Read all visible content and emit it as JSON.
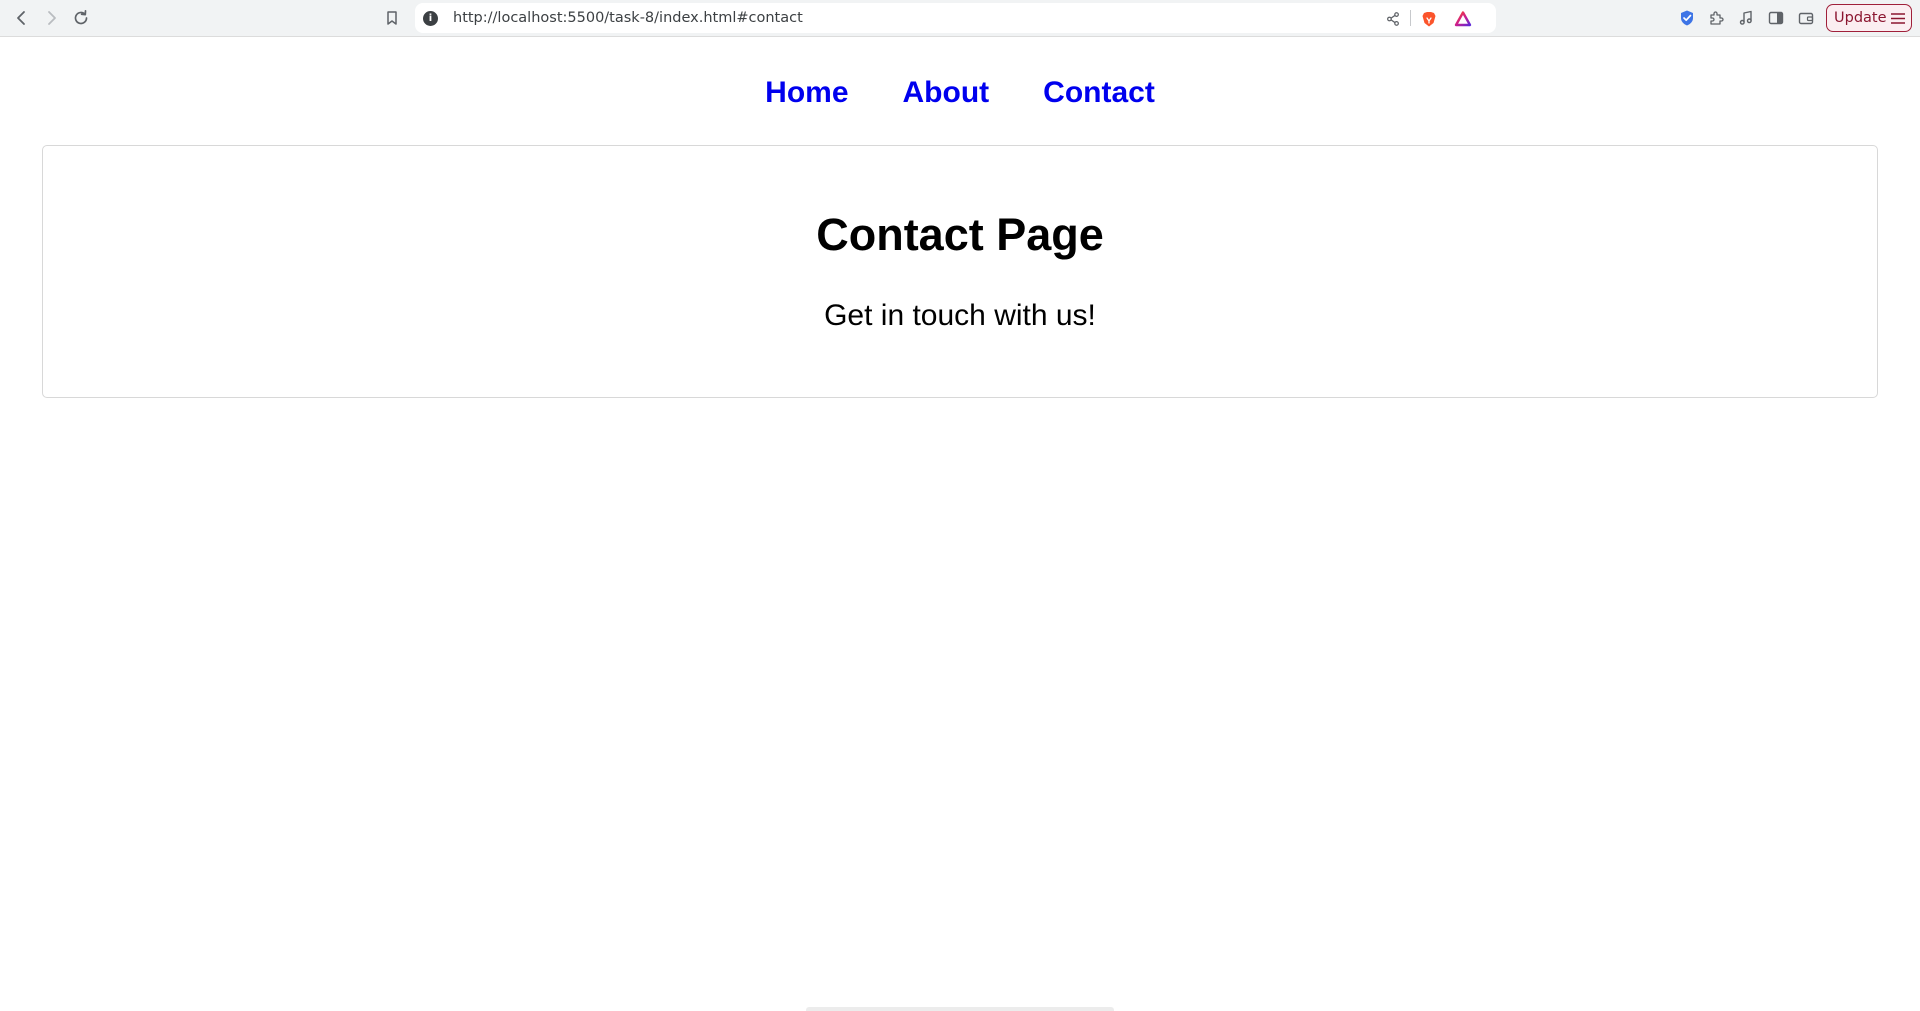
{
  "browser": {
    "url": "http://localhost:5500/task-8/index.html#contact",
    "update_label": "Update",
    "icons": {
      "back": "back-arrow-icon",
      "forward": "forward-arrow-icon",
      "reload": "reload-icon",
      "bookmark": "bookmark-icon",
      "site_info": "info-icon",
      "share": "share-icon",
      "brave_shields": "brave-lion-icon",
      "brave_rewards": "brave-rewards-triangle-icon",
      "vpn": "shield-check-icon",
      "extensions": "puzzle-icon",
      "media": "music-note-icon",
      "sidebar": "sidebar-icon",
      "wallet": "wallet-icon",
      "menu": "hamburger-menu-icon"
    },
    "colors": {
      "brave_orange": "#fb542b",
      "update_accent": "#a0203a"
    }
  },
  "nav": {
    "home": "Home",
    "about": "About",
    "contact": "Contact",
    "link_color": "#0000ee"
  },
  "content": {
    "title": "Contact Page",
    "text": "Get in touch with us!"
  }
}
